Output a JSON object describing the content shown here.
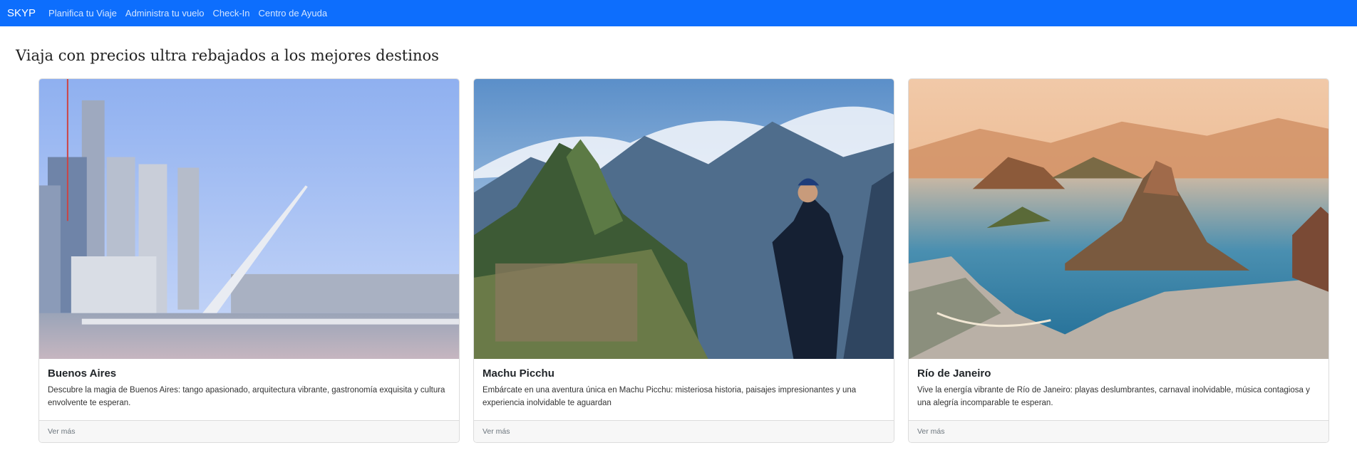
{
  "navbar": {
    "brand": "SKYP",
    "links": [
      "Planifica tu Viaje",
      "Administra tu vuelo",
      "Check-In",
      "Centro de Ayuda"
    ]
  },
  "heading": "Viaja con precios ultra rebajados a los mejores destinos",
  "cards": [
    {
      "title": "Buenos Aires",
      "text": "Descubre la magia de Buenos Aires: tango apasionado, arquitectura vibrante, gastronomía exquisita y cultura envolvente te esperan.",
      "footer": "Ver más",
      "image": "buenos-aires-bridge-photo"
    },
    {
      "title": "Machu Picchu",
      "text": "Embárcate en una aventura única en Machu Picchu: misteriosa historia, paisajes impresionantes y una experiencia inolvidable te aguardan",
      "footer": "Ver más",
      "image": "machu-picchu-hiker-photo"
    },
    {
      "title": "Río de Janeiro",
      "text": "Vive la energía vibrante de Río de Janeiro: playas deslumbrantes, carnaval inolvidable, música contagiosa y una alegría incomparable te esperan.",
      "footer": "Ver más",
      "image": "rio-de-janeiro-bay-photo"
    }
  ],
  "colors": {
    "navbar": "#0d6efd"
  }
}
